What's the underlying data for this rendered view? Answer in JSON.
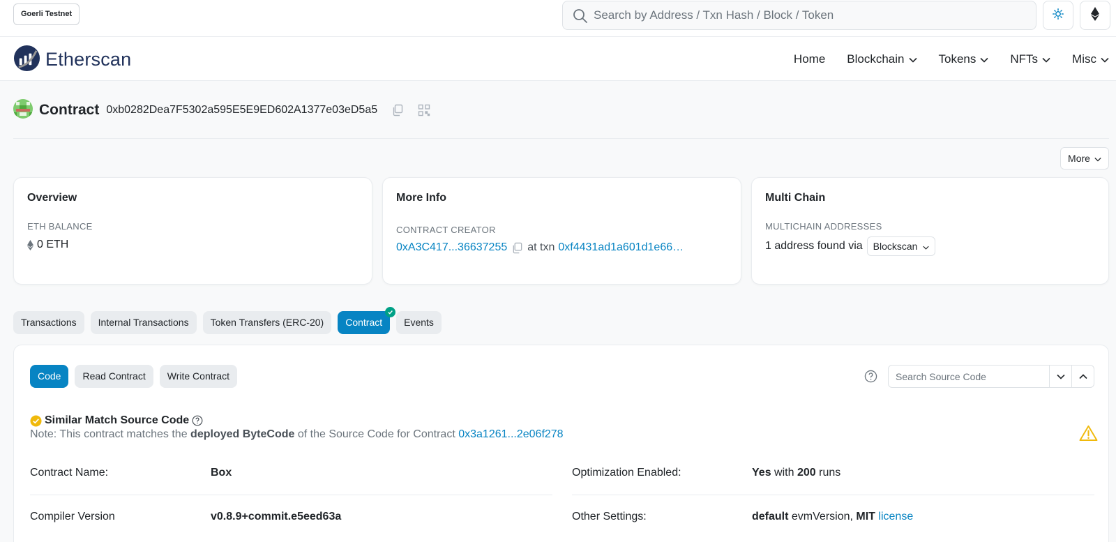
{
  "topbar": {
    "network": "Goerli Testnet",
    "search_placeholder": "Search by Address / Txn Hash / Block / Token"
  },
  "brand": {
    "name": "Etherscan"
  },
  "nav": [
    {
      "label": "Home"
    },
    {
      "label": "Blockchain"
    },
    {
      "label": "Tokens"
    },
    {
      "label": "NFTs"
    },
    {
      "label": "Misc"
    }
  ],
  "contract": {
    "title": "Contract",
    "address": "0xb0282Dea7F5302a595E5E9ED602A1377e03eD5a5"
  },
  "more_button": "More",
  "overview": {
    "title": "Overview",
    "balance_label": "ETH BALANCE",
    "balance_value": "0 ETH"
  },
  "more_info": {
    "title": "More Info",
    "creator_label": "CONTRACT CREATOR",
    "creator_addr": "0xA3C417...36637255",
    "at_txn": "at txn",
    "txn_hash": "0xf4431ad1a601d1e66…"
  },
  "multichain": {
    "title": "Multi Chain",
    "label": "MULTICHAIN ADDRESSES",
    "found_text": "1 address found via",
    "select_value": "Blockscan"
  },
  "tabs": [
    {
      "label": "Transactions"
    },
    {
      "label": "Internal Transactions"
    },
    {
      "label": "Token Transfers (ERC-20)"
    },
    {
      "label": "Contract"
    },
    {
      "label": "Events"
    }
  ],
  "subtabs": [
    {
      "label": "Code"
    },
    {
      "label": "Read Contract"
    },
    {
      "label": "Write Contract"
    }
  ],
  "source_search_placeholder": "Search Source Code",
  "match": {
    "title": "Similar Match Source Code",
    "note_prefix": "Note: This contract matches the",
    "note_bold": "deployed ByteCode",
    "note_mid": "of the Source Code for Contract",
    "note_link": "0x3a1261...2e06f278"
  },
  "details": {
    "contract_name_label": "Contract Name:",
    "contract_name_value": "Box",
    "compiler_label": "Compiler Version",
    "compiler_value": "v0.8.9+commit.e5eed63a",
    "optimization_label": "Optimization Enabled:",
    "optimization_yes": "Yes",
    "optimization_with": "with",
    "optimization_runs": "200",
    "optimization_runs_suffix": "runs",
    "other_label": "Other Settings:",
    "other_default": "default",
    "other_evm": "evmVersion,",
    "other_mit": "MIT",
    "other_license": "license"
  },
  "colors": {
    "primary": "#0784c3",
    "brand_navy": "#21325b",
    "success": "#00a186",
    "warning": "#f0b90b"
  }
}
